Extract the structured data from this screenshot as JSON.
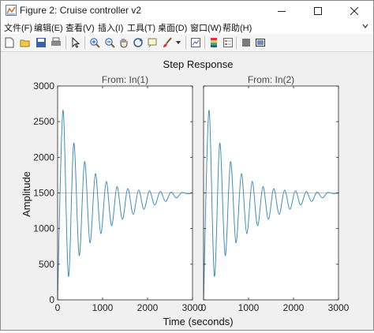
{
  "window": {
    "title": "Figure 2: Cruise controller v2"
  },
  "menu": [
    "文件(F)",
    "编辑(E)",
    "查看(V)",
    "插入(I)",
    "工具(T)",
    "桌面(D)",
    "窗口(W)",
    "帮助(H)"
  ],
  "toolbar": {
    "icons": [
      "new-figure-icon",
      "open-icon",
      "save-icon",
      "print-icon",
      "edit-plot-arrow-icon",
      "zoom-in-icon",
      "zoom-out-icon",
      "pan-hand-icon",
      "rotate-3d-icon",
      "data-cursor-icon",
      "brush-icon",
      "brush-dropdown-icon",
      "link-plot-icon",
      "insert-colorbar-icon",
      "insert-legend-icon",
      "hide-plot-tools-icon",
      "show-plot-tools-icon"
    ]
  },
  "chart_data": {
    "type": "line",
    "title": "Step Response",
    "xlabel": "Time (seconds)",
    "ylabel": "Amplitude",
    "xlim": [
      0,
      3000
    ],
    "ylim": [
      0,
      3000
    ],
    "xticks": [
      0,
      1000,
      2000,
      3000
    ],
    "yticks": [
      0,
      500,
      1000,
      1500,
      2000,
      2500,
      3000
    ],
    "final_value": 1500,
    "panels": [
      {
        "title": "From: In(1)",
        "x_tick_labels": [
          "0",
          "1000",
          "2000",
          "3000"
        ],
        "series": [
          {
            "x": [
              0,
              120,
              240,
              360,
              480,
              600,
              720,
              840,
              960,
              1080,
              1200,
              1320,
              1440,
              1560,
              1680,
              1800,
              1920,
              2040,
              2160,
              2280,
              2400,
              2520,
              2640,
              2760,
              2880,
              3000
            ],
            "y": [
              0,
              2660,
              330,
              2200,
              620,
              1940,
              800,
              1770,
              930,
              1660,
              1040,
              1590,
              1130,
              1560,
              1200,
              1540,
              1270,
              1530,
              1330,
              1520,
              1380,
              1510,
              1430,
              1505,
              1490,
              1500
            ]
          }
        ]
      },
      {
        "title": "From: In(2)",
        "x_tick_labels": [
          "0",
          "1000",
          "2000",
          "3000"
        ],
        "series": [
          {
            "x": [
              0,
              120,
              240,
              360,
              480,
              600,
              720,
              840,
              960,
              1080,
              1200,
              1320,
              1440,
              1560,
              1680,
              1800,
              1920,
              2040,
              2160,
              2280,
              2400,
              2520,
              2640,
              2760,
              2880,
              3000
            ],
            "y": [
              0,
              2660,
              330,
              2200,
              620,
              1940,
              800,
              1770,
              930,
              1660,
              1040,
              1590,
              1130,
              1560,
              1200,
              1540,
              1270,
              1530,
              1330,
              1520,
              1380,
              1510,
              1430,
              1505,
              1490,
              1500
            ]
          }
        ]
      }
    ],
    "line_color": "#3f8cc0",
    "final_value_color": "#b0b0b0",
    "grid": false
  }
}
